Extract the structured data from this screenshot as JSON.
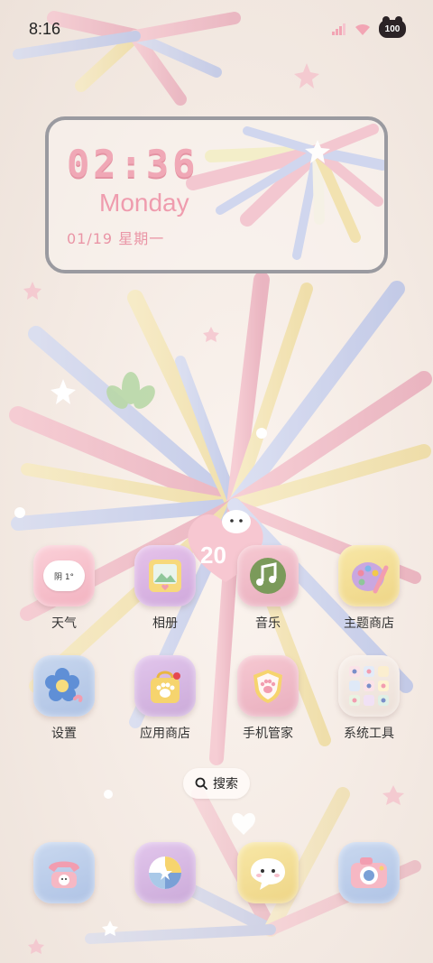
{
  "status_bar": {
    "time": "8:16",
    "battery": "100"
  },
  "clock_widget": {
    "time": "02:36",
    "day": "Monday",
    "date": "01/19  星期一"
  },
  "wallpaper": {
    "center_text": "20"
  },
  "apps": [
    {
      "label": "天气",
      "icon": "weather-cloud-icon",
      "icon_text": "阴 1°"
    },
    {
      "label": "相册",
      "icon": "photo-album-icon"
    },
    {
      "label": "音乐",
      "icon": "music-note-icon"
    },
    {
      "label": "主题商店",
      "icon": "palette-icon"
    },
    {
      "label": "设置",
      "icon": "flower-gear-icon"
    },
    {
      "label": "应用商店",
      "icon": "shopping-bag-icon"
    },
    {
      "label": "手机管家",
      "icon": "paw-shield-icon"
    },
    {
      "label": "系统工具",
      "icon": "tools-grid-icon"
    }
  ],
  "search": {
    "label": "搜索"
  },
  "dock": [
    {
      "icon": "phone-icon"
    },
    {
      "icon": "browser-icon"
    },
    {
      "icon": "messages-icon"
    },
    {
      "icon": "camera-icon"
    }
  ],
  "colors": {
    "clock_pink": "#f0a8b6",
    "widget_border": "#9a9aa0",
    "label_text": "#333333"
  }
}
